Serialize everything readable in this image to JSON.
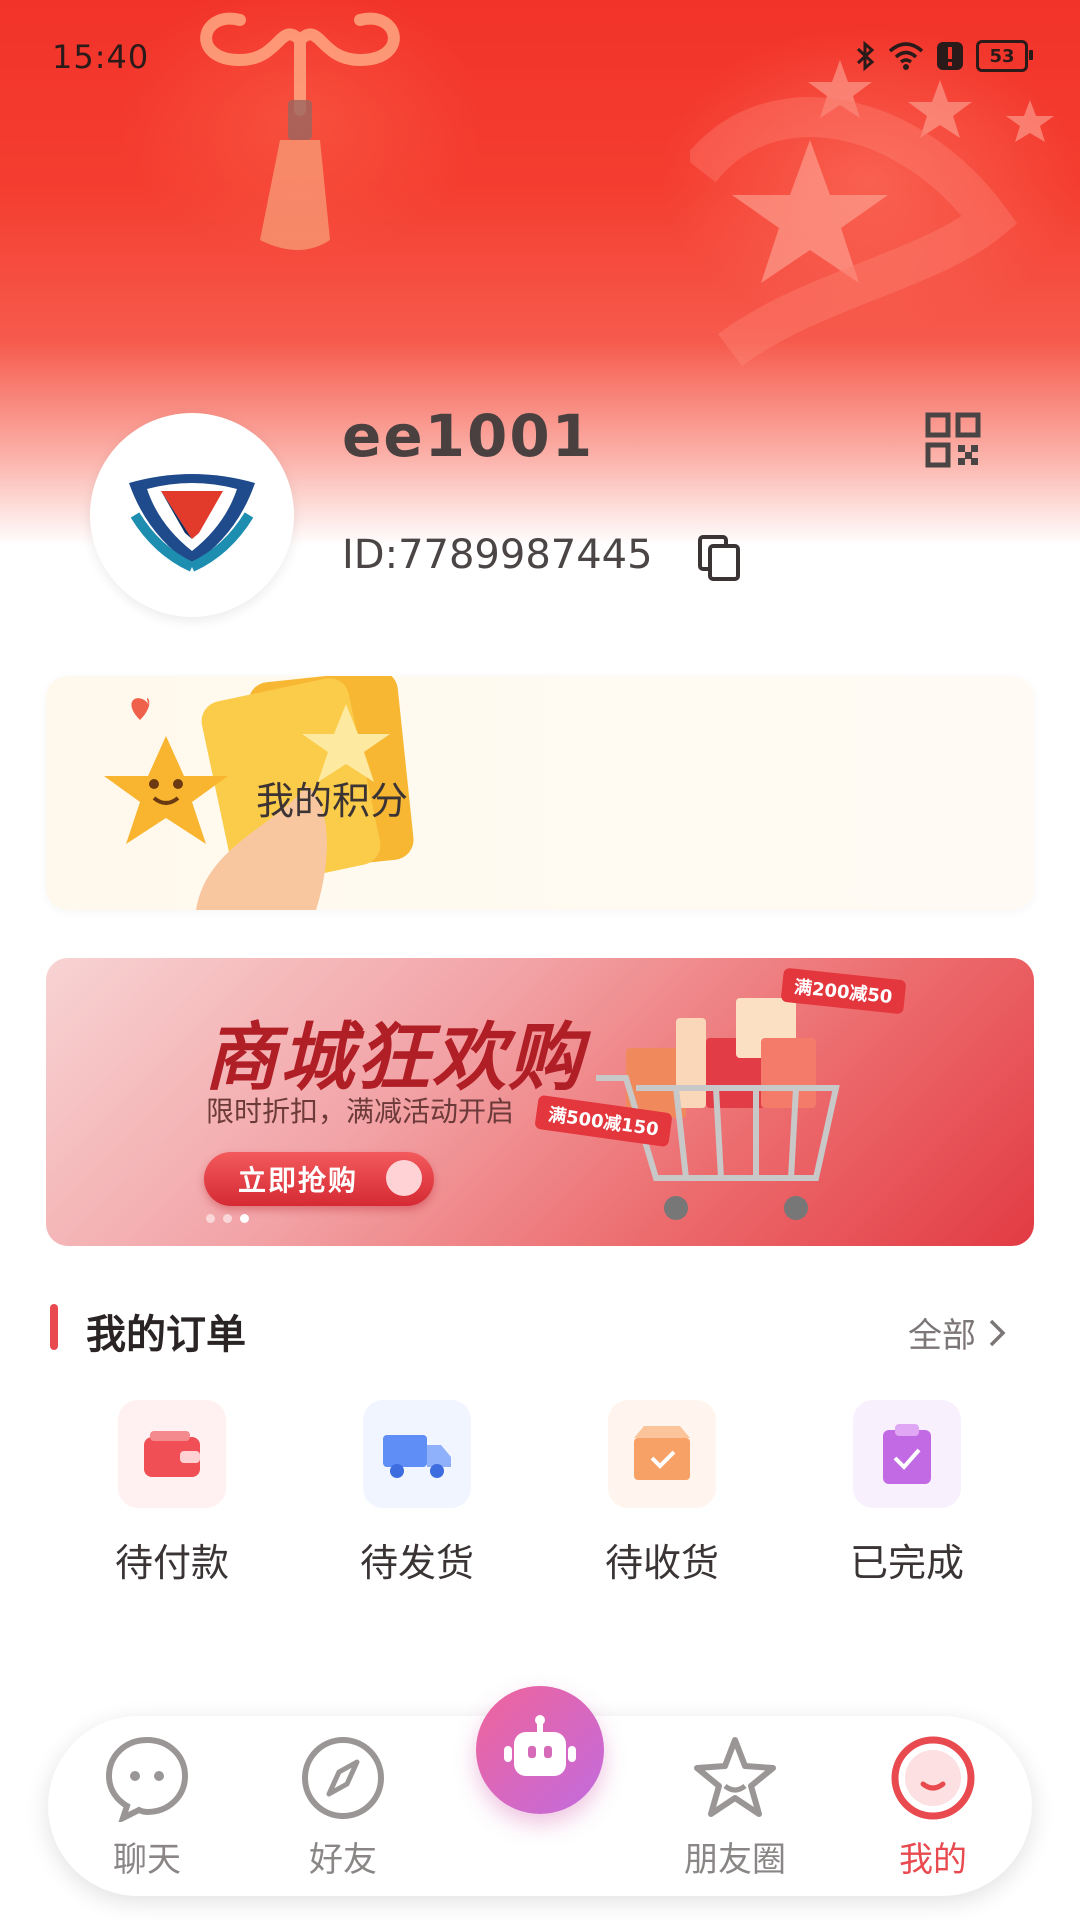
{
  "status_bar": {
    "time": "15:40",
    "battery": "53"
  },
  "profile": {
    "username": "ee1001",
    "id_text": "ID:7789987445"
  },
  "points": {
    "label": "我的积分"
  },
  "banner": {
    "title": "商城狂欢购",
    "subtitle": "限时折扣，满减活动开启",
    "button": "立即抢购",
    "tag_1": "满200减50",
    "tag_2": "满500减150",
    "slide_count": 3,
    "active_slide": 3
  },
  "orders": {
    "title": "我的订单",
    "all_label": "全部",
    "items": [
      {
        "label": "待付款",
        "icon": "wallet-icon",
        "color": "#ef4f55"
      },
      {
        "label": "待发货",
        "icon": "truck-icon",
        "color": "#5f8ef6"
      },
      {
        "label": "待收货",
        "icon": "package-icon",
        "color": "#f7a166"
      },
      {
        "label": "已完成",
        "icon": "clipboard-check-icon",
        "color": "#c26ae4"
      }
    ]
  },
  "tabbar": {
    "items": [
      {
        "label": "聊天",
        "icon": "chat-bubble-icon"
      },
      {
        "label": "好友",
        "icon": "compass-icon"
      },
      {
        "label": "",
        "icon": "robot-icon"
      },
      {
        "label": "朋友圈",
        "icon": "star-icon"
      },
      {
        "label": "我的",
        "icon": "smile-face-icon",
        "active": true
      }
    ]
  },
  "colors": {
    "accent": "#e84a4f",
    "header_red": "#f2332a"
  }
}
